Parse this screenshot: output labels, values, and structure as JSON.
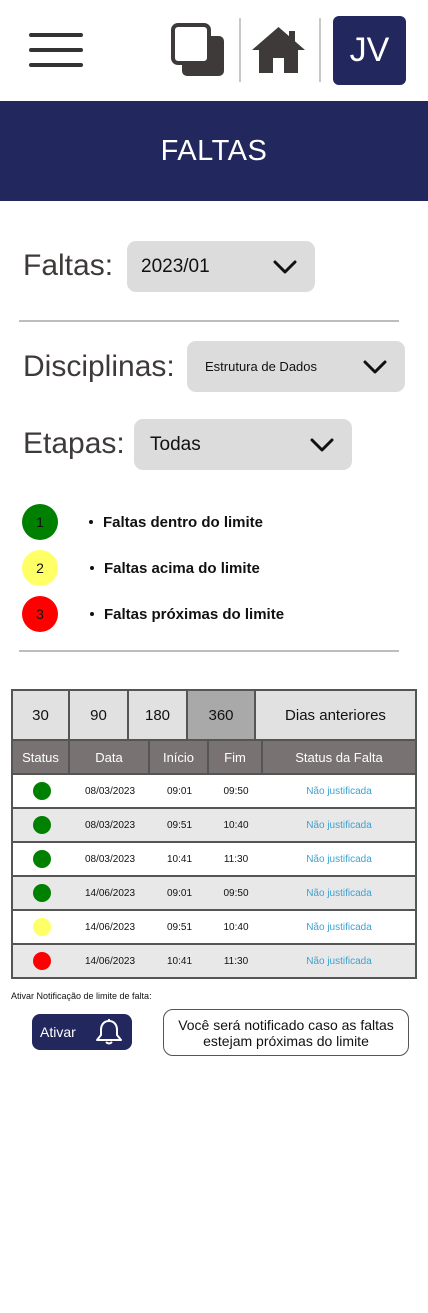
{
  "header": {
    "avatar_initials": "JV",
    "page_title": "FALTAS"
  },
  "filters": {
    "faltas_label": "Faltas:",
    "faltas_value": "2023/01",
    "disciplinas_label": "Disciplinas:",
    "disciplinas_value": "Estrutura de Dados",
    "etapas_label": "Etapas:",
    "etapas_value": "Todas"
  },
  "legend": [
    {
      "number": "1",
      "color": "#008000",
      "text": "Faltas dentro do limite"
    },
    {
      "number": "2",
      "color": "#ffff66",
      "text": "Faltas acima do limite"
    },
    {
      "number": "3",
      "color": "#ff0000",
      "text": "Faltas próximas do limite"
    }
  ],
  "period_filters": [
    "30",
    "90",
    "180",
    "360",
    "Dias anteriores"
  ],
  "selected_period": "360",
  "table": {
    "headers": [
      "Status",
      "Data",
      "Início",
      "Fim",
      "Status da Falta"
    ],
    "rows": [
      {
        "status_color": "#008000",
        "data": "08/03/2023",
        "inicio": "09:01",
        "fim": "09:50",
        "status_falta": "Não justificada"
      },
      {
        "status_color": "#008000",
        "data": "08/03/2023",
        "inicio": "09:51",
        "fim": "10:40",
        "status_falta": "Não justificada"
      },
      {
        "status_color": "#008000",
        "data": "08/03/2023",
        "inicio": "10:41",
        "fim": "11:30",
        "status_falta": "Não justificada"
      },
      {
        "status_color": "#008000",
        "data": "14/06/2023",
        "inicio": "09:01",
        "fim": "09:50",
        "status_falta": "Não justificada"
      },
      {
        "status_color": "#ffff66",
        "data": "14/06/2023",
        "inicio": "09:51",
        "fim": "10:40",
        "status_falta": "Não justificada"
      },
      {
        "status_color": "#ff0000",
        "data": "14/06/2023",
        "inicio": "10:41",
        "fim": "11:30",
        "status_falta": "Não justificada"
      }
    ]
  },
  "notification": {
    "label": "Ativar Notificação de limite de falta:",
    "button_label": "Ativar",
    "message": "Você será notificado caso as faltas estejam próximas do limite"
  },
  "colors": {
    "brand": "#22275d",
    "link": "#3ba3d4",
    "table_header": "#797272"
  }
}
